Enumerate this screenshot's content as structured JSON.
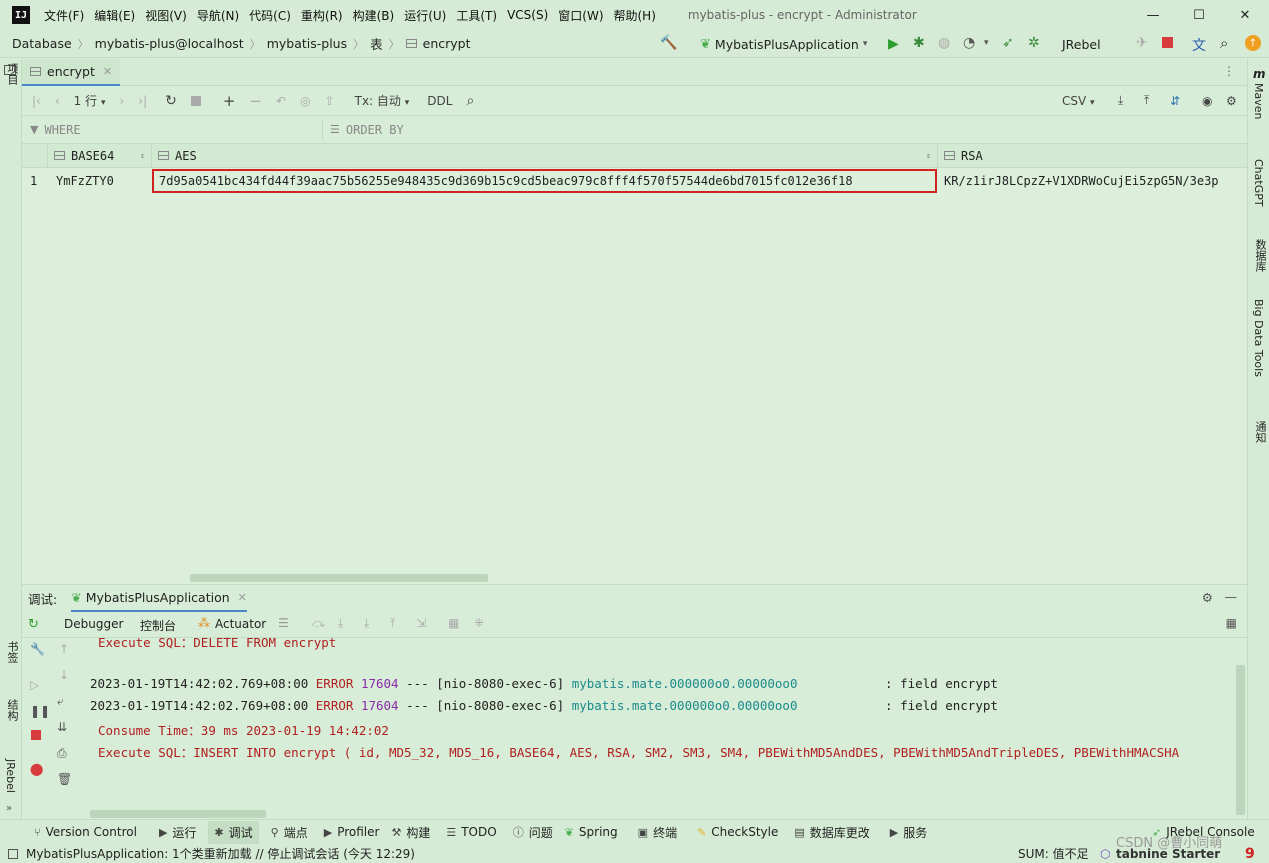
{
  "app": {
    "logo": "IJ",
    "title": "mybatis-plus - encrypt - Administrator",
    "menu": [
      "文件(F)",
      "编辑(E)",
      "视图(V)",
      "导航(N)",
      "代码(C)",
      "重构(R)",
      "构建(B)",
      "运行(U)",
      "工具(T)",
      "VCS(S)",
      "窗口(W)",
      "帮助(H)"
    ],
    "window_controls": {
      "minimize": "—",
      "maximize": "☐",
      "close": "✕"
    }
  },
  "breadcrumbs": [
    "Database",
    "mybatis-plus@localhost",
    "mybatis-plus",
    "表",
    "encrypt"
  ],
  "toolbar": {
    "run_config": "MybatisPlusApplication",
    "jrebel": "JRebel"
  },
  "left_strip": {
    "project": "项目",
    "bookmarks": "书签",
    "structure": "结构",
    "jrebel": "JRebel"
  },
  "right_strip": {
    "maven": "Maven",
    "chatgpt": "ChatGPT",
    "database": "数据库",
    "bigdata": "Big Data Tools",
    "notifications": "通知"
  },
  "editor_tab": {
    "label": "encrypt"
  },
  "data_toolbar": {
    "rows": "1 行",
    "tx": "Tx: 自动",
    "ddl": "DDL",
    "export_format": "CSV"
  },
  "filter": {
    "where": "WHERE",
    "order_by": "ORDER BY"
  },
  "grid": {
    "columns": [
      "BASE64",
      "AES",
      "RSA"
    ],
    "rows": [
      {
        "num": "1",
        "BASE64": "YmFzZTY0",
        "AES": "7d95a0541bc434fd44f39aac75b56255e948435c9d369b15c9cd5beac979c8fff4f570f57544de6bd7015fc012e36f18",
        "RSA": "KR/z1irJ8LCpzZ+V1XDRWoCujEi5zpG5N/3e3p"
      }
    ]
  },
  "debug": {
    "label": "调试:",
    "session": "MybatisPlusApplication",
    "tabs": [
      "Debugger",
      "控制台",
      "Actuator"
    ],
    "console": {
      "line0": "Execute SQL：DELETE FROM encrypt",
      "log1": {
        "ts": "2023-01-19T14:42:02.769+08:00",
        "level": "ERROR",
        "pid": "17604",
        "sep": "---",
        "thread": "[nio-8080-exec-6]",
        "logger": "mybatis.mate.000000o0.00000oo0",
        "msg": ": field encrypt"
      },
      "log2": {
        "ts": "2023-01-19T14:42:02.769+08:00",
        "level": "ERROR",
        "pid": "17604",
        "sep": "---",
        "thread": "[nio-8080-exec-6]",
        "logger": "mybatis.mate.000000o0.00000oo0",
        "msg": ": field encrypt"
      },
      "consume": "Consume Time：39 ms 2023-01-19 14:42:02",
      "exec": "Execute SQL：INSERT INTO encrypt ( id, MD5_32, MD5_16, BASE64, AES, RSA, SM2, SM3, SM4, PBEWithMD5AndDES, PBEWithMD5AndTripleDES, PBEWithHMACSHA"
    }
  },
  "bottom_tools": [
    "Version Control",
    "运行",
    "调试",
    "端点",
    "Profiler",
    "构建",
    "TODO",
    "问题",
    "Spring",
    "终端",
    "CheckStyle",
    "数据库更改",
    "服务",
    "JRebel Console"
  ],
  "status": {
    "message": "MybatisPlusApplication: 1个类重新加载 // 停止调试会话 (今天 12:29)",
    "sum": "SUM: 值不足",
    "tabnine": "tabnine Starter",
    "watermark": "CSDN @曹小同萌"
  },
  "colors": {
    "accent": "#4a86c8",
    "highlight_box": "#d02020",
    "error": "#b02020",
    "logger": "#1b8a8a",
    "pid": "#8a2aa8"
  }
}
